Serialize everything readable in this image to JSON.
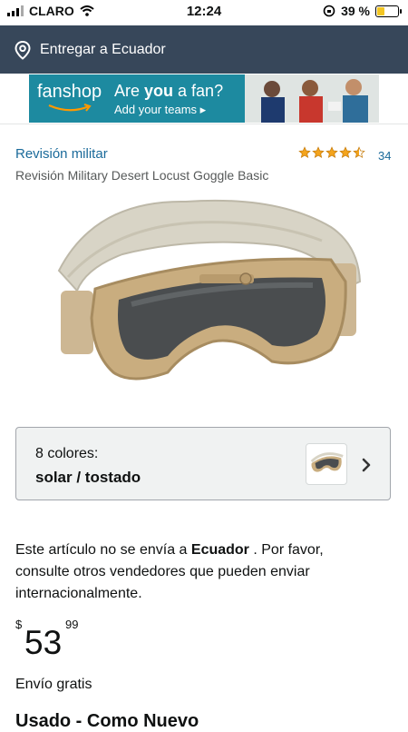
{
  "status_bar": {
    "carrier": "CLARO",
    "time": "12:24",
    "battery_percent": "39 %",
    "battery_level": 0.39
  },
  "delivery": {
    "label": "Entregar a Ecuador",
    "icon": "location-pin-icon"
  },
  "banner": {
    "logo": "fanshop",
    "headline_pre": "Are ",
    "headline_bold": "you",
    "headline_post": " a fan?",
    "cta": "Add your teams ▸"
  },
  "product": {
    "brand": "Revisión militar",
    "rating": 4.5,
    "review_count": "34",
    "title": "Revisión Military Desert Locust Goggle Basic"
  },
  "colors": {
    "count_label": "8 colores:",
    "selected": "solar / tostado"
  },
  "shipping_notice": {
    "pre": "Este artículo no se envía a ",
    "country": "Ecuador",
    "post": " . Por favor, consulte otros vendedores que pueden enviar internacionalmente."
  },
  "price": {
    "currency": "$",
    "whole": "53",
    "fraction": "99"
  },
  "shipping": "Envío gratis",
  "condition": "Usado - Como Nuevo",
  "colors_theme": {
    "header": "#37475a",
    "link": "#1a6a9a",
    "star": "#f4a41c",
    "banner": "#1d8aa0"
  }
}
